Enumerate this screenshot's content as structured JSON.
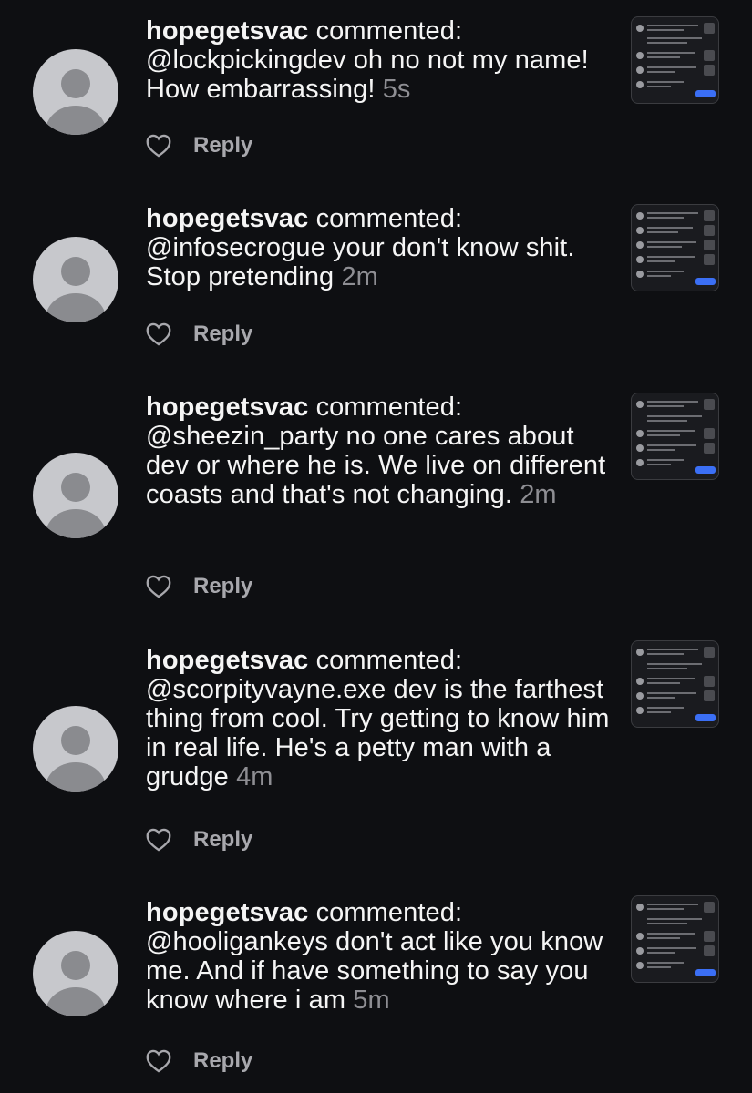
{
  "comments": [
    {
      "username": "hopegetsvac",
      "action": "commented:",
      "text": "@lockpickingdev oh no not my name! How embarrassing!",
      "time": "5s",
      "reply_label": "Reply"
    },
    {
      "username": "hopegetsvac",
      "action": "commented:",
      "text": "@infosecrogue your don't know shit. Stop pretending",
      "time": "2m",
      "reply_label": "Reply"
    },
    {
      "username": "hopegetsvac",
      "action": "commented:",
      "text": "@sheezin_party no one cares about dev or where he is. We live on different coasts and that's not changing.",
      "time": "2m",
      "reply_label": "Reply"
    },
    {
      "username": "hopegetsvac",
      "action": "commented:",
      "text": "@scorpityvayne.exe dev is the farthest thing from cool. Try getting to know him in real life. He's a petty man with a grudge",
      "time": "4m",
      "reply_label": "Reply"
    },
    {
      "username": "hopegetsvac",
      "action": "commented:",
      "text": "@hooligankeys don't act like you know me. And if have something to say you know where i am",
      "time": "5m",
      "reply_label": "Reply"
    }
  ],
  "colors": {
    "background": "#0e0f12",
    "text": "#f5f5f5",
    "muted": "#8e8e93",
    "reply": "#a8a8ad",
    "avatar_bg": "#c7c8cc",
    "avatar_fg": "#8a8b8f",
    "follow_button": "#3b6ff5"
  },
  "icons": {
    "like": "heart-outline-icon",
    "avatar": "default-profile-icon"
  }
}
